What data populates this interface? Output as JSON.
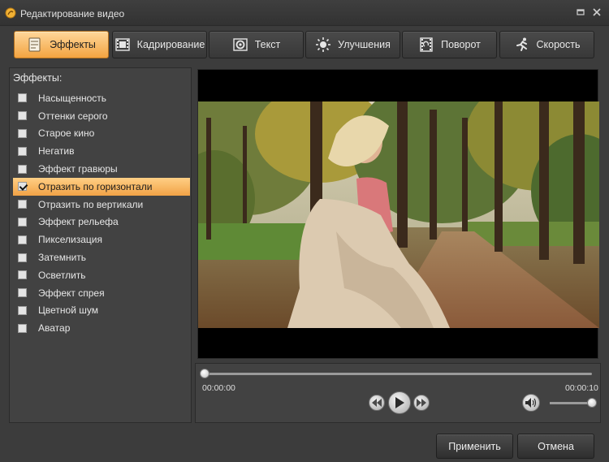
{
  "window": {
    "title": "Редактирование видео",
    "icon": "app-logo-icon",
    "controls": {
      "maximize_icon": "maximize-icon",
      "close_icon": "close-icon"
    }
  },
  "tabs": [
    {
      "label": "Эффекты",
      "icon": "effects-icon",
      "active": true
    },
    {
      "label": "Кадрирование",
      "icon": "crop-film-icon",
      "active": false
    },
    {
      "label": "Текст",
      "icon": "text-icon",
      "active": false
    },
    {
      "label": "Улучшения",
      "icon": "sun-icon",
      "active": false
    },
    {
      "label": "Поворот",
      "icon": "rotate-icon",
      "active": false
    },
    {
      "label": "Скорость",
      "icon": "running-man-icon",
      "active": false
    }
  ],
  "effects_panel": {
    "header": "Эффекты:",
    "items": [
      {
        "label": "Насыщенность",
        "checked": false
      },
      {
        "label": "Оттенки серого",
        "checked": false
      },
      {
        "label": "Старое кино",
        "checked": false
      },
      {
        "label": "Негатив",
        "checked": false
      },
      {
        "label": "Эффект гравюры",
        "checked": false
      },
      {
        "label": "Отразить по горизонтали",
        "checked": true
      },
      {
        "label": "Отразить по вертикали",
        "checked": false
      },
      {
        "label": "Эффект рельефа",
        "checked": false
      },
      {
        "label": "Пикселизация",
        "checked": false
      },
      {
        "label": "Затемнить",
        "checked": false
      },
      {
        "label": "Осветлить",
        "checked": false
      },
      {
        "label": "Эффект спрея",
        "checked": false
      },
      {
        "label": "Цветной шум",
        "checked": false
      },
      {
        "label": "Аватар",
        "checked": false
      }
    ]
  },
  "player": {
    "current_time": "00:00:00",
    "total_time": "00:00:10",
    "progress": 0,
    "volume": 1.0,
    "buttons": {
      "prev_icon": "skip-back-icon",
      "play_icon": "play-icon",
      "next_icon": "skip-forward-icon",
      "volume_icon": "speaker-icon"
    }
  },
  "footer": {
    "apply_label": "Применить",
    "cancel_label": "Отмена"
  },
  "colors": {
    "accent": "#f3a441",
    "accent_light": "#ffd79a",
    "background": "#3c3c3c"
  }
}
